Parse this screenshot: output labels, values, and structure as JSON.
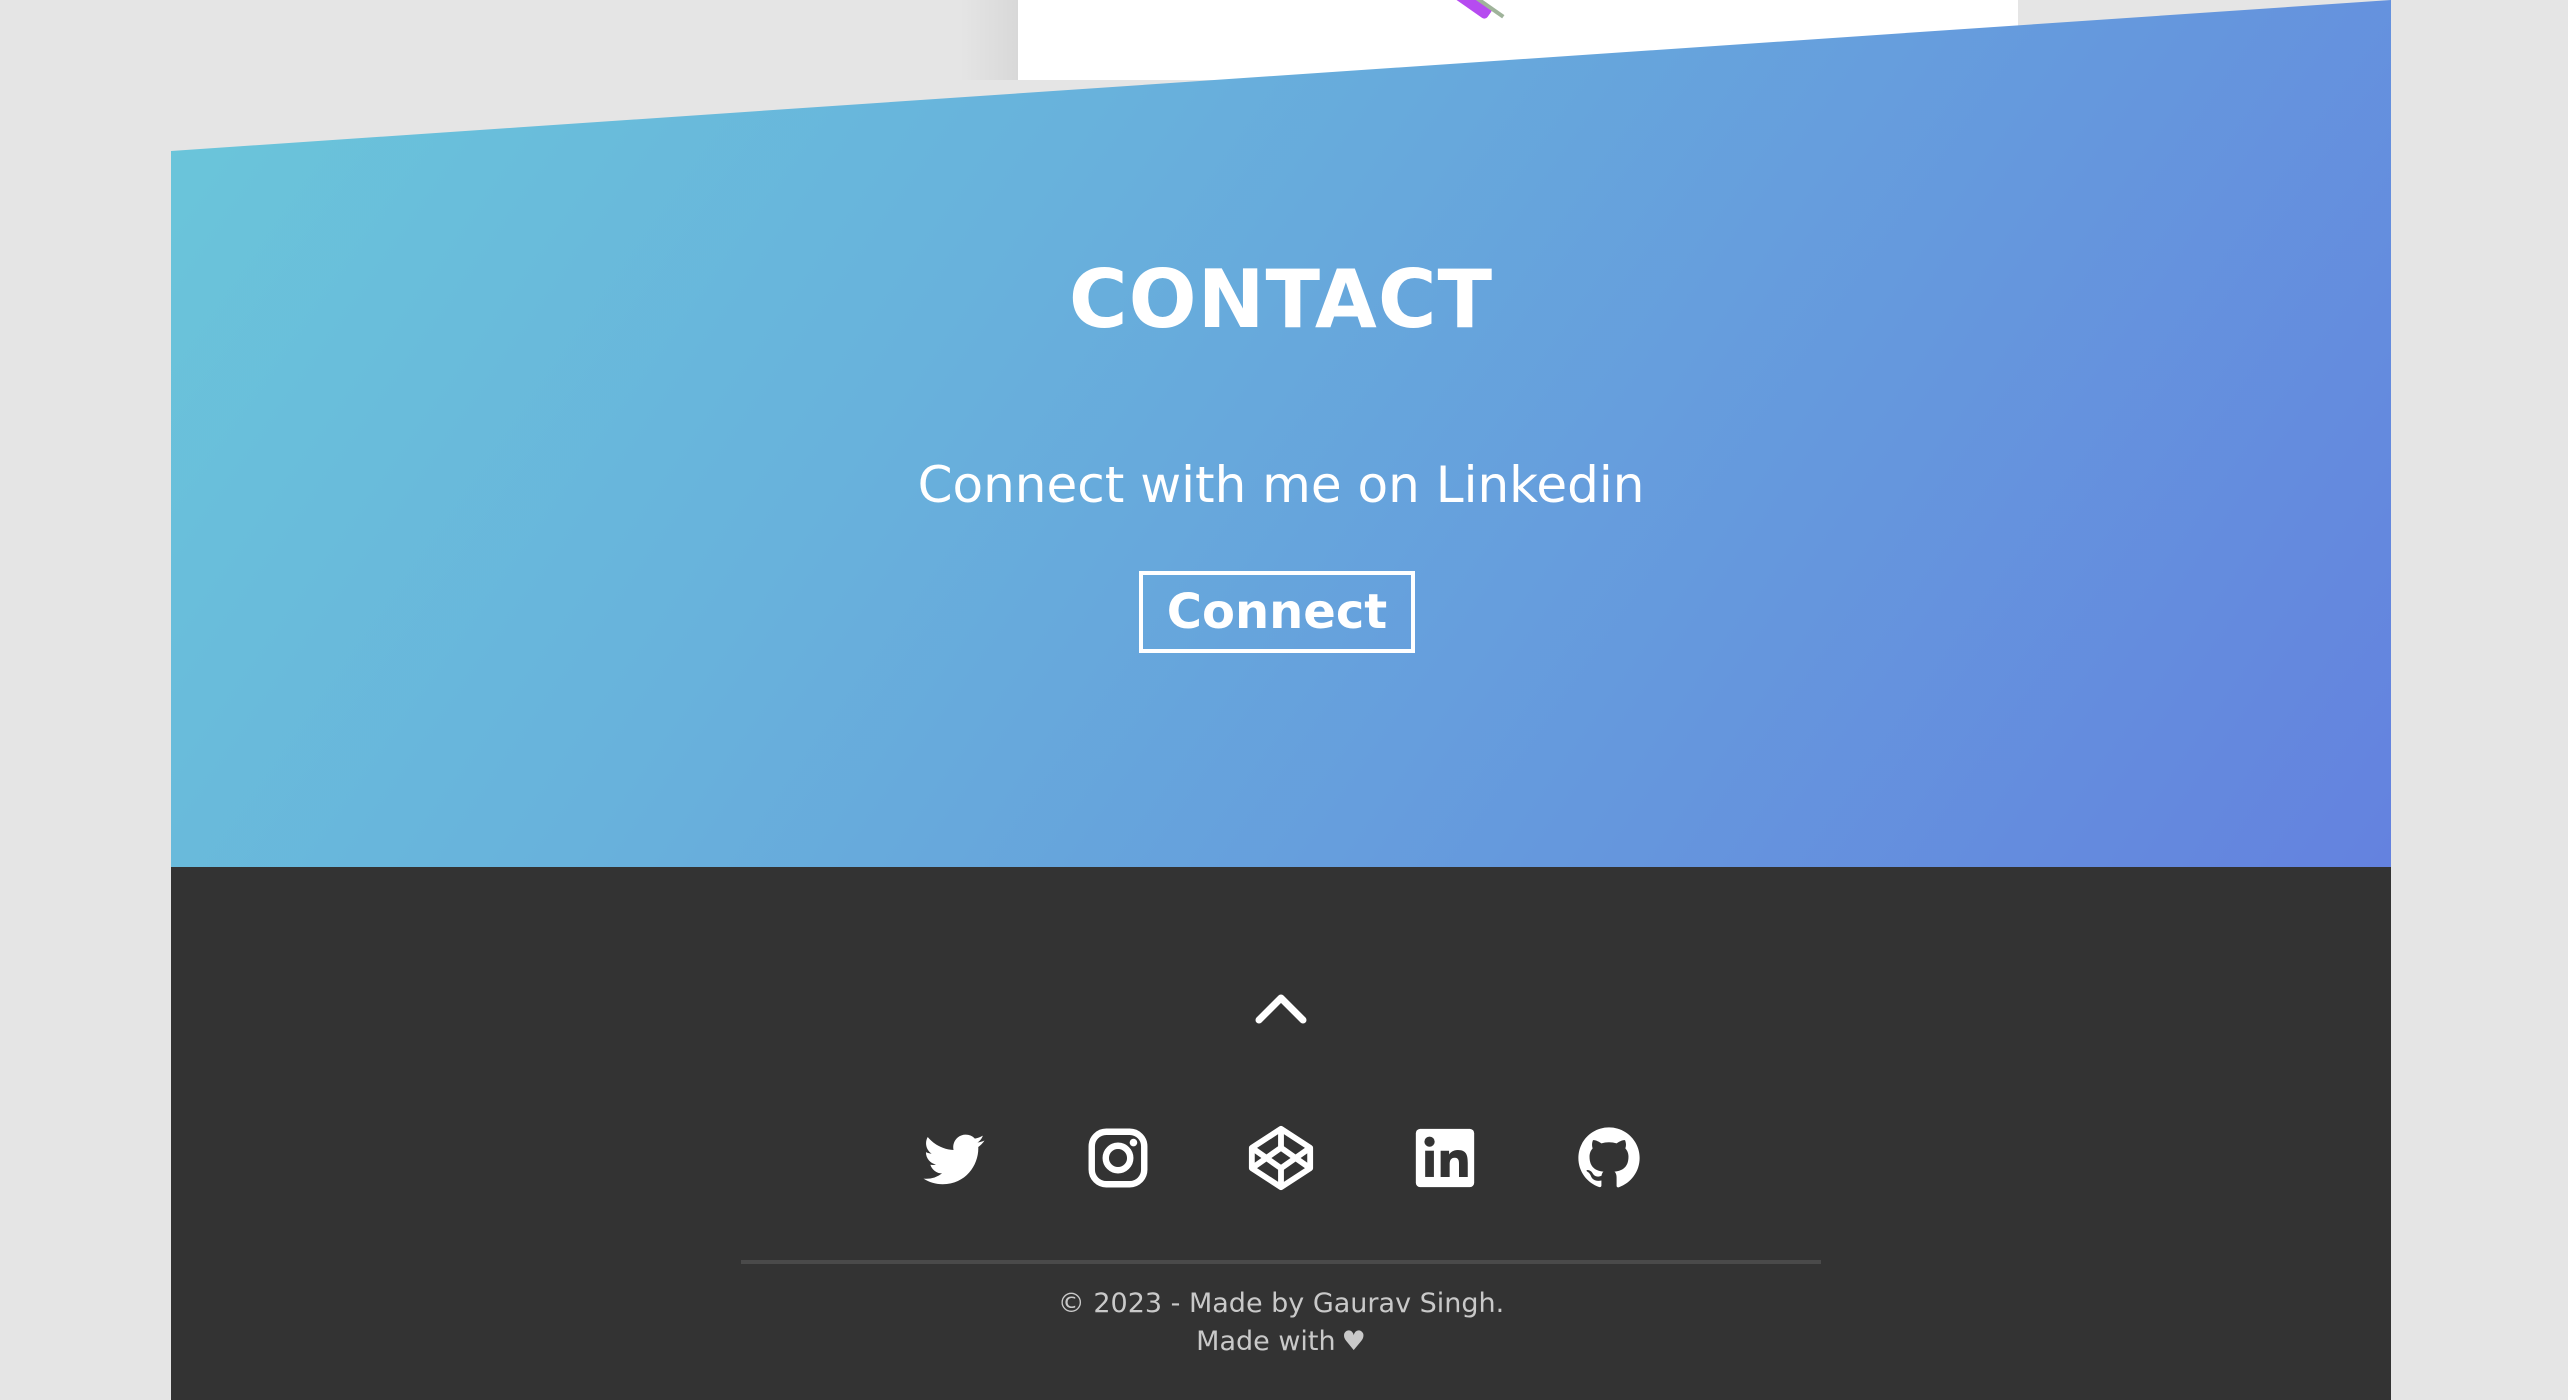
{
  "contact": {
    "title": "CONTACT",
    "subtitle": "Connect with me on Linkedin",
    "button_label": "Connect"
  },
  "footer": {
    "back_to_top_icon": "chevron-up-icon",
    "socials": [
      {
        "name": "Twitter",
        "icon": "twitter-icon"
      },
      {
        "name": "Instagram",
        "icon": "instagram-icon"
      },
      {
        "name": "CodePen",
        "icon": "codepen-icon"
      },
      {
        "name": "LinkedIn",
        "icon": "linkedin-icon"
      },
      {
        "name": "GitHub",
        "icon": "github-icon"
      }
    ],
    "copyright": "© 2023 - Made by Gaurav Singh.",
    "made_with": "Made with",
    "heart_symbol": "♥"
  },
  "colors": {
    "gradient_start": "#6ac7da",
    "gradient_end": "#6482df",
    "footer_bg": "#333333",
    "page_bg": "#e5e5e5",
    "footer_text": "#c9c9c9"
  }
}
